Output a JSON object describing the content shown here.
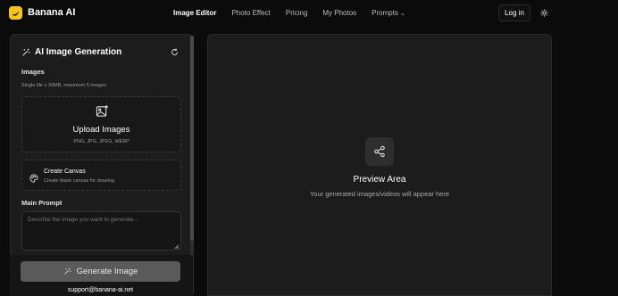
{
  "brand": {
    "name": "Banana AI"
  },
  "nav": {
    "items": [
      {
        "label": "Image Editor",
        "active": true
      },
      {
        "label": "Photo Effect",
        "active": false
      },
      {
        "label": "Pricing",
        "active": false
      },
      {
        "label": "My Photos",
        "active": false
      },
      {
        "label": "Prompts",
        "active": false,
        "caret": "⌄"
      }
    ],
    "login_label": "Log in",
    "theme_icon": "sun-icon"
  },
  "panel": {
    "title": "AI Image Generation",
    "title_icon": "magic-wand-icon",
    "reset_icon": "refresh-icon",
    "images_label": "Images",
    "images_hint": "Single file ≤ 30MB, maximum 5 images",
    "upload": {
      "icon": "image-plus-icon",
      "title": "Upload Images",
      "formats": "PNG, JPG, JPEG, WEBP"
    },
    "canvas": {
      "icon": "palette-icon",
      "title": "Create Canvas",
      "subtitle": "Create blank canvas for drawing"
    },
    "prompt_label": "Main Prompt",
    "prompt_placeholder": "Describe the image you want to generate...",
    "generate_label": "Generate Image",
    "generate_icon": "magic-wand-icon",
    "support_email": "support@banana-ai.net"
  },
  "preview": {
    "icon": "share-icon",
    "title": "Preview Area",
    "subtitle": "Your generated images/videos will appear here"
  },
  "colors": {
    "background": "#0b0b0b",
    "panel": "#1c1c1c",
    "brand_accent": "#f5c518",
    "button_disabled": "#5a5a5a"
  }
}
